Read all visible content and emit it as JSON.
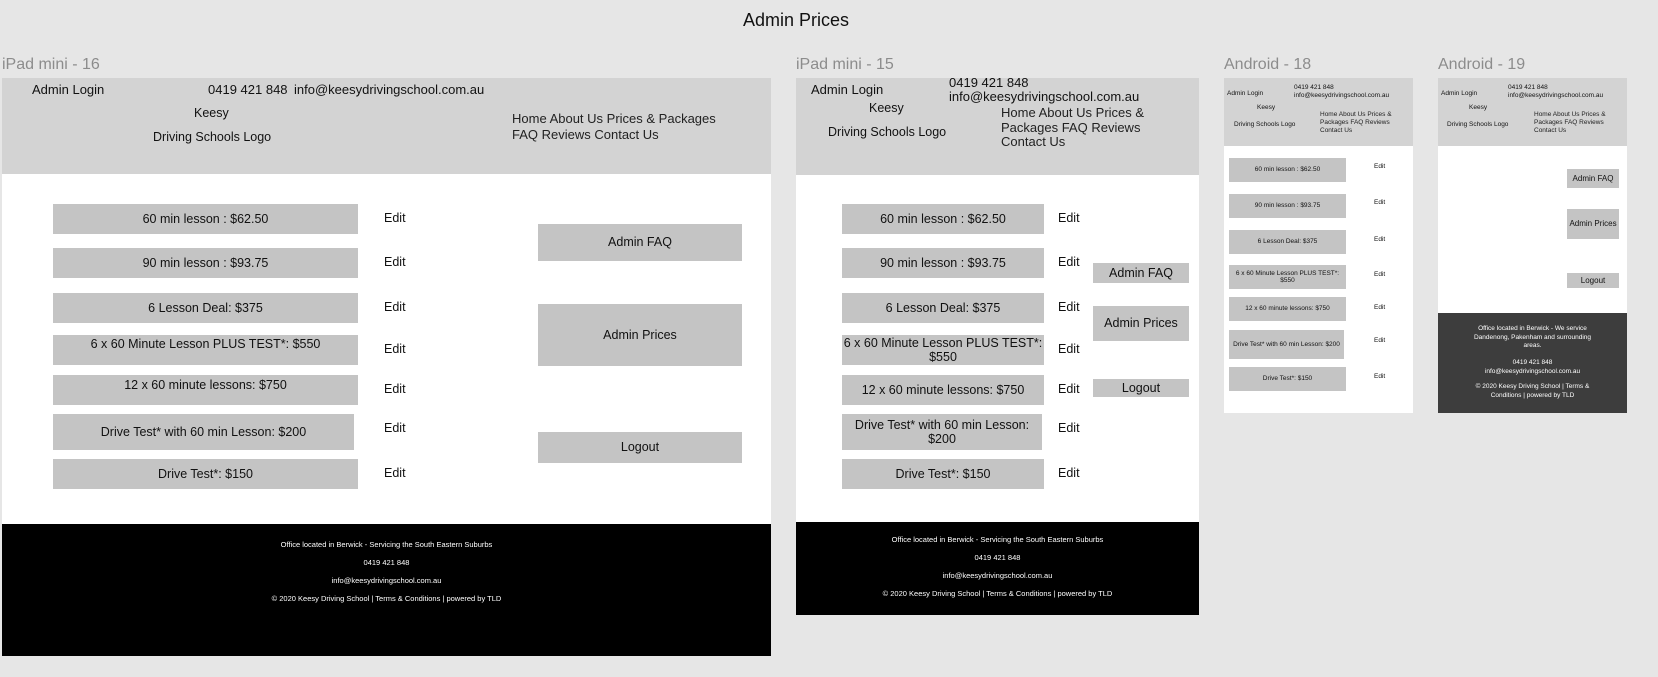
{
  "page_title": "Admin Prices",
  "header": {
    "admin_login": "Admin Login",
    "phone": "0419 421 848",
    "email": "info@keesydrivingschool.com.au",
    "logo_line1": "Keesy",
    "logo_line2": "Driving Schools Logo",
    "nav": "Home About Us Prices & Packages FAQ Reviews Contact Us"
  },
  "prices": [
    {
      "label": "60 min lesson : $62.50"
    },
    {
      "label": "90 min lesson : $93.75"
    },
    {
      "label": "6 Lesson Deal: $375"
    },
    {
      "label": "6 x 60 Minute Lesson PLUS TEST*: $550"
    },
    {
      "label": "12 x 60 minute lessons: $750"
    },
    {
      "label": "Drive Test* with 60 min Lesson: $200"
    },
    {
      "label": "Drive Test*: $150"
    }
  ],
  "edit_label": "Edit",
  "buttons": {
    "admin_faq": "Admin FAQ",
    "admin_prices": "Admin Prices",
    "logout": "Logout"
  },
  "frames": {
    "ipad16": "iPad mini - 16",
    "ipad15": "iPad mini - 15",
    "android18": "Android - 18",
    "android19": "Android - 19"
  },
  "footer": {
    "office": "Office located in Berwick - Servicing the South Eastern Suburbs",
    "office_android": "Office located in Berwick - We service Dandenong, Pakenham and surrounding areas.",
    "phone": "0419 421 848",
    "email": "info@keesydrivingschool.com.au",
    "copyright": "© 2020 Keesy Driving School | Terms & Conditions | powered by TLD"
  },
  "colors": {
    "canvas": "#e6e6e6",
    "header": "#d3d3d3",
    "box": "#c4c4c4",
    "footer_black": "#000000",
    "footer_dark": "#3d3d3d",
    "frame_label": "#8c8c8c"
  }
}
